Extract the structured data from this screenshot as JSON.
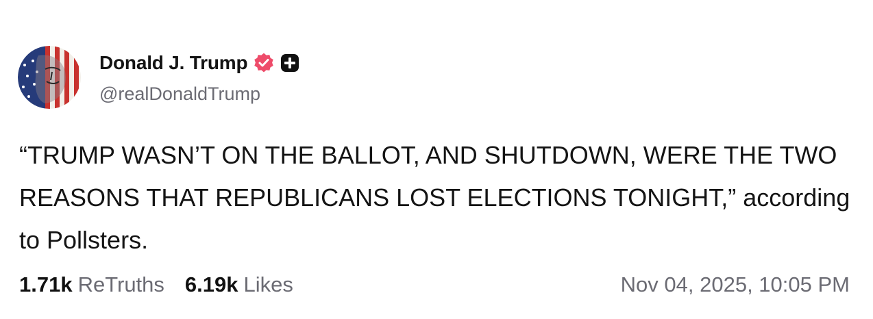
{
  "author": {
    "display_name": "Donald J. Trump",
    "handle": "@realDonaldTrump",
    "avatar_icon": "flag-portrait-avatar",
    "verified_icon": "verified-badge-icon",
    "verified_color": "#ee4c6a",
    "plus_icon": "plus-badge-icon"
  },
  "post": {
    "text": "“TRUMP WASN’T ON THE BALLOT, AND SHUTDOWN, WERE THE TWO REASONS THAT REPUBLICANS LOST ELECTIONS TONIGHT,” according to Pollsters."
  },
  "stats": {
    "retruths_count": "1.71k",
    "retruths_label": "ReTruths",
    "likes_count": "6.19k",
    "likes_label": "Likes"
  },
  "timestamp": "Nov 04, 2025, 10:05 PM"
}
